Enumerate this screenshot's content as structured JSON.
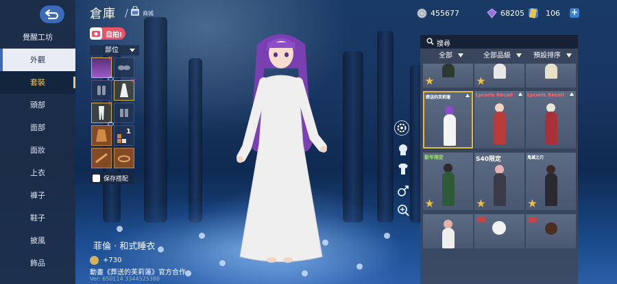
{
  "sidebar": {
    "title": "覺醒工坊",
    "items": [
      {
        "label": "外觀"
      },
      {
        "label": "套裝"
      },
      {
        "label": "頭部"
      },
      {
        "label": "面部"
      },
      {
        "label": "面妝"
      },
      {
        "label": "上衣"
      },
      {
        "label": "褲子"
      },
      {
        "label": "鞋子"
      },
      {
        "label": "披風"
      },
      {
        "label": "飾品"
      }
    ]
  },
  "header": {
    "title": "倉庫",
    "separator": "/",
    "shop_label": "商城"
  },
  "currencies": [
    {
      "icon": "silver-coin-icon",
      "value": "455677"
    },
    {
      "icon": "diamond-icon",
      "value": "68205"
    },
    {
      "icon": "ticket-icon",
      "value": "106"
    }
  ],
  "outfit_panel": {
    "selfie_label": "自拍!",
    "part_dropdown": "部位",
    "save_label": "保存搭配",
    "slot_count_label": "1"
  },
  "item_info": {
    "name": "菲倫 · 和式睡衣",
    "price": "+730",
    "collab": "動畫《葬送的芙莉蓮》官方合作",
    "version": "Ver: 650114 3344525388"
  },
  "store": {
    "search_label": "搜尋",
    "filters": [
      {
        "label": "全部"
      },
      {
        "label": "全部品級"
      },
      {
        "label": "預設排序"
      }
    ],
    "cards": [
      {
        "tag": ""
      },
      {
        "tag": ""
      },
      {
        "tag": ""
      },
      {
        "tag": "葬送的芙莉蓮"
      },
      {
        "tag": "Lycoris Recoil"
      },
      {
        "tag": "Lycoris Recoil"
      },
      {
        "tag": "新年限定"
      },
      {
        "tag": "S40限定"
      },
      {
        "tag": "鬼滅之刃"
      },
      {
        "tag": ""
      },
      {
        "tag": ""
      },
      {
        "tag": ""
      }
    ]
  },
  "colors": {
    "accent_blue": "#3a6ab8",
    "gold": "#e2b94a",
    "selfie_pink": "#e85566",
    "sidebar_bg": "#1c2c46"
  }
}
